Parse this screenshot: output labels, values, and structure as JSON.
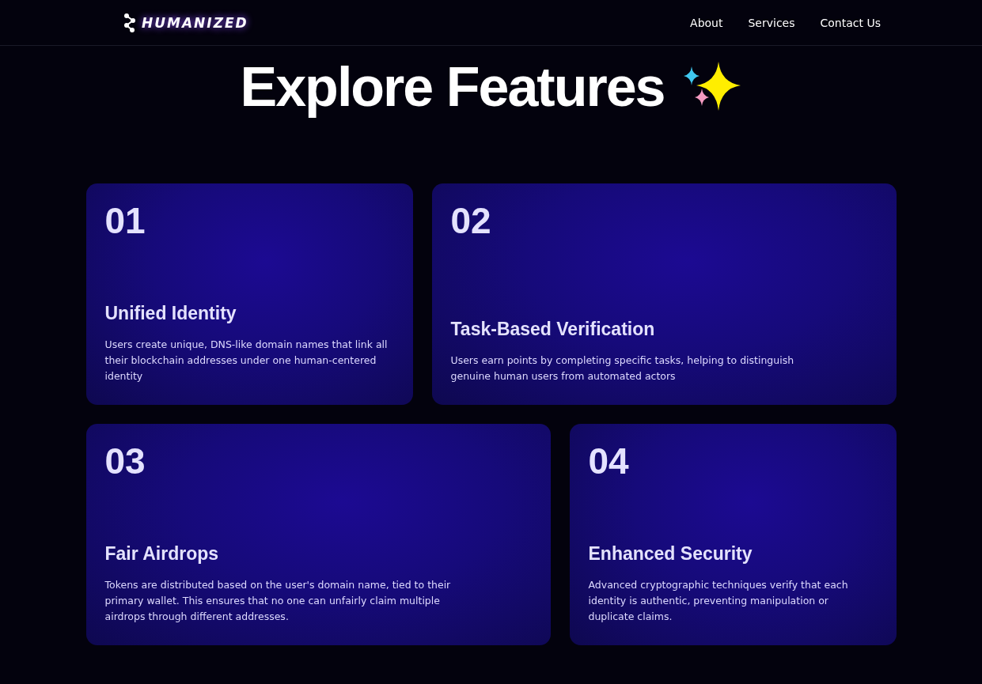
{
  "nav": {
    "logo": "HUMANIZED",
    "links": [
      "About",
      "Services",
      "Contact Us"
    ]
  },
  "heading": "Explore Features",
  "features": [
    {
      "number": "01",
      "title": "Unified Identity",
      "description": "Users create unique, DNS-like domain names that link all their blockchain addresses under one human-centered identity",
      "wide": false
    },
    {
      "number": "02",
      "title": "Task-Based Verification",
      "description": "Users earn points by completing specific tasks, helping to distinguish genuine human users from automated actors",
      "wide": true
    },
    {
      "number": "03",
      "title": "Fair Airdrops",
      "description": "Tokens are distributed based on the user's domain name, tied to their primary wallet. This ensures that no one can unfairly claim multiple airdrops through different addresses.",
      "wide": true
    },
    {
      "number": "04",
      "title": "Enhanced Security",
      "description": "Advanced cryptographic techniques verify that each identity is authentic, preventing manipulation or duplicate claims.",
      "wide": false
    }
  ]
}
